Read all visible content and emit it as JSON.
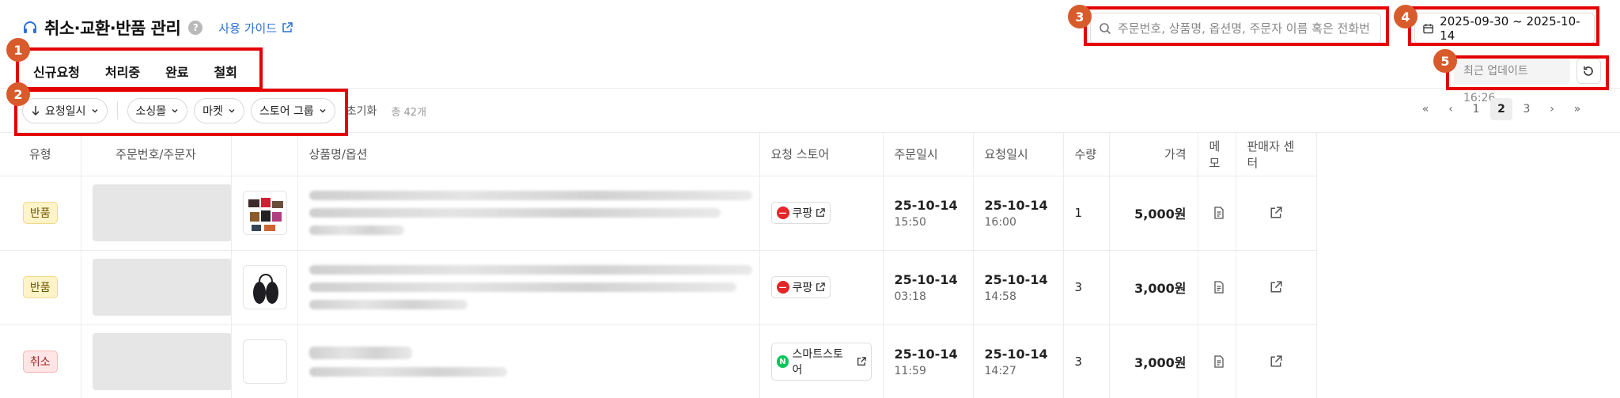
{
  "header": {
    "title": "취소·교환·반품 관리",
    "help_icon": "?",
    "guide_label": "사용 가이드"
  },
  "tabs": [
    "신규요청",
    "처리중",
    "완료",
    "철회"
  ],
  "search": {
    "placeholder": "주문번호, 상품명, 옵션명, 주문자 이름 혹은 전화번"
  },
  "date_range": "2025-09-30 ~ 2025-10-14",
  "update": {
    "label": "최근 업데이트 16:26"
  },
  "filters": {
    "sort": "요청일시",
    "chips": [
      "소싱몰",
      "마켓",
      "스토어 그룹"
    ],
    "reset": "초기화",
    "total": "총 42개"
  },
  "pagination": {
    "pages": [
      "1",
      "2",
      "3"
    ],
    "current": "2"
  },
  "columns": [
    "유형",
    "주문번호/주문자",
    "",
    "상품명/옵션",
    "요청 스토어",
    "주문일시",
    "요청일시",
    "수량",
    "가격",
    "메모",
    "판매자 센터"
  ],
  "rows": [
    {
      "type": "반품",
      "type_kind": "return",
      "store": "쿠팡",
      "store_kind": "coupang",
      "order_date": "25-10-14",
      "order_time": "15:50",
      "req_date": "25-10-14",
      "req_time": "16:00",
      "qty": "1",
      "price": "5,000원"
    },
    {
      "type": "반품",
      "type_kind": "return",
      "store": "쿠팡",
      "store_kind": "coupang",
      "order_date": "25-10-14",
      "order_time": "03:18",
      "req_date": "25-10-14",
      "req_time": "14:58",
      "qty": "3",
      "price": "3,000원"
    },
    {
      "type": "취소",
      "type_kind": "cancel",
      "store": "스마트스토어",
      "store_kind": "smartstore",
      "order_date": "25-10-14",
      "order_time": "11:59",
      "req_date": "25-10-14",
      "req_time": "14:27",
      "qty": "3",
      "price": "3,000원"
    }
  ],
  "callouts": [
    "1",
    "2",
    "3",
    "4",
    "5"
  ],
  "colors": {
    "accent": "#2f6fd6",
    "marker": "#e40000",
    "callout": "#d85b2c",
    "coupang": "#e52528",
    "naver": "#03c75a"
  },
  "icons": {
    "headset": "headset-icon",
    "search": "search-icon",
    "calendar": "calendar-icon",
    "refresh": "refresh-icon",
    "memo": "document-icon",
    "external": "external-link-icon"
  }
}
